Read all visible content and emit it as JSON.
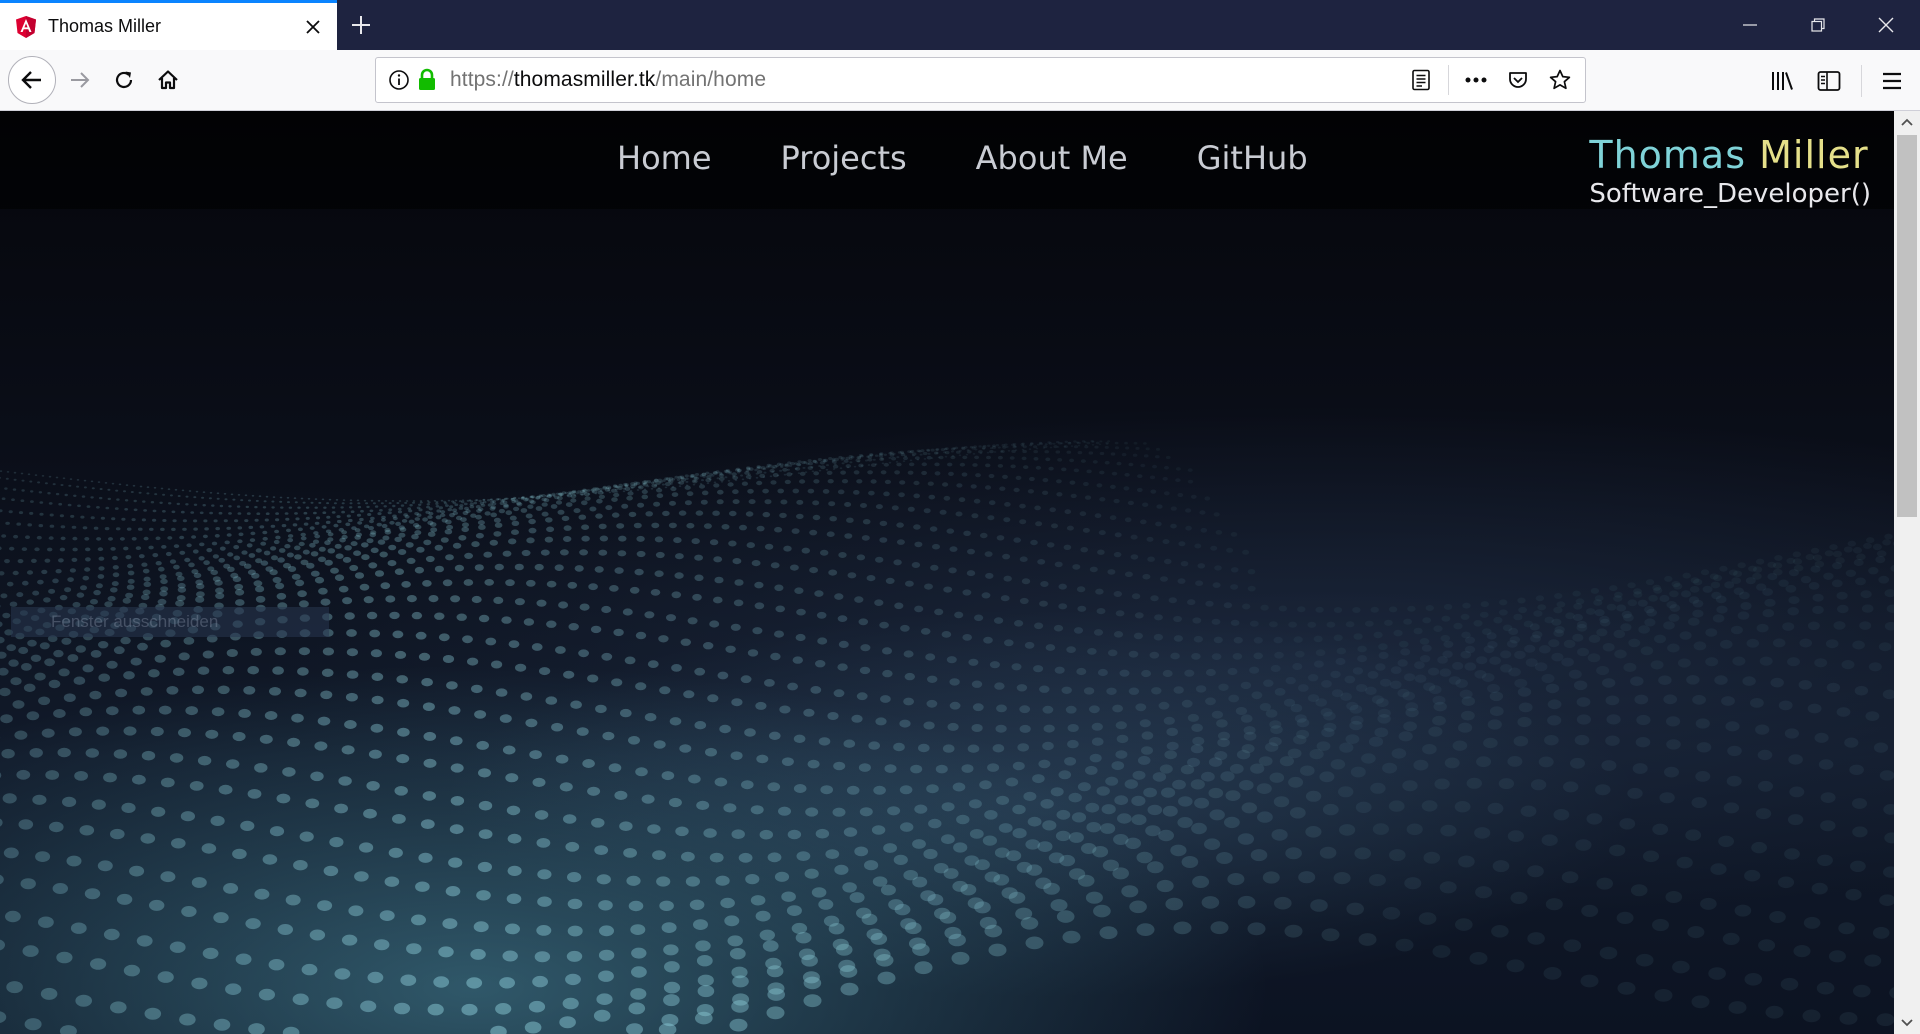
{
  "browser": {
    "tab": {
      "title": "Thomas Miller",
      "favicon": "angular-icon"
    },
    "url": {
      "scheme": "https://",
      "domain": "thomasmiller.tk",
      "path": "/main/home"
    }
  },
  "site": {
    "nav": [
      "Home",
      "Projects",
      "About Me",
      "GitHub"
    ],
    "brand": {
      "first": "Thomas",
      "last": "Miller",
      "subtitle": "Software_Developer()"
    },
    "overlay_text": "Fenster ausschneiden"
  },
  "colors": {
    "brand_first": "#7fd3d8",
    "brand_last": "#e5e08a",
    "tabbar": "#1e2340",
    "tab_accent": "#0a84ff",
    "lock": "#12bc00"
  }
}
